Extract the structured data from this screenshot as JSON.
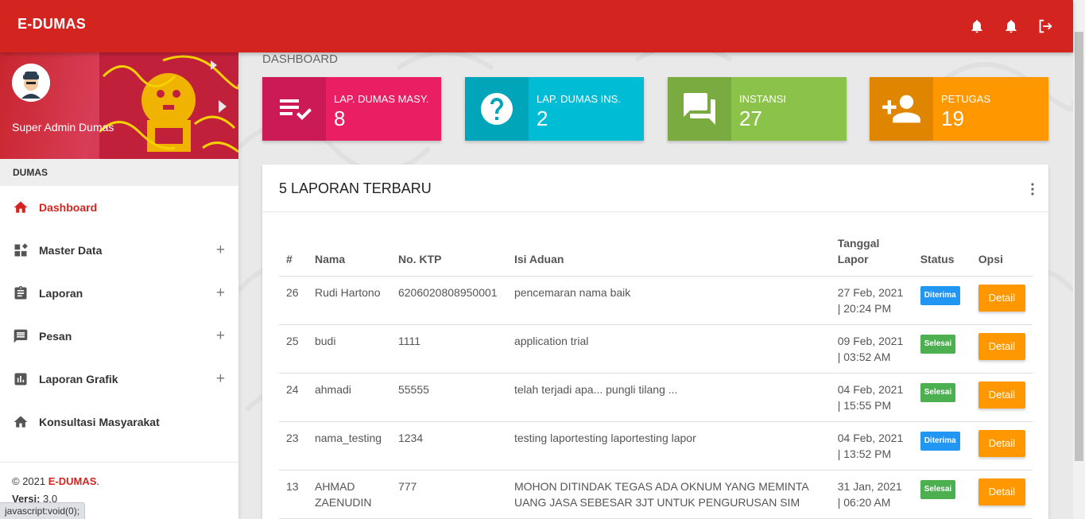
{
  "app": {
    "brand": "E-DUMAS"
  },
  "topbar": {
    "icons": [
      "bell-icon",
      "bell-icon",
      "logout-icon"
    ]
  },
  "sidebar": {
    "user_name": "Super Admin Dumas",
    "section_header": "DUMAS",
    "items": [
      {
        "label": "Dashboard",
        "icon": "home-icon",
        "active": true,
        "expandable": false
      },
      {
        "label": "Master Data",
        "icon": "dashboard-icon",
        "active": false,
        "expandable": true
      },
      {
        "label": "Laporan",
        "icon": "clipboard-icon",
        "active": false,
        "expandable": true
      },
      {
        "label": "Pesan",
        "icon": "message-icon",
        "active": false,
        "expandable": true
      },
      {
        "label": "Laporan Grafik",
        "icon": "bar-chart-icon",
        "active": false,
        "expandable": true
      },
      {
        "label": "Konsultasi Masyarakat",
        "icon": "home-icon",
        "active": false,
        "expandable": false
      }
    ],
    "plus_symbol": "+",
    "footer": {
      "copyright": "© 2021 ",
      "brand": "E-DUMAS",
      "period": ".",
      "version_label": "Versi:",
      "version_value": " 3.0"
    }
  },
  "status_tooltip": "javascript:void(0);",
  "main": {
    "page_title": "DASHBOARD",
    "info_boxes": [
      {
        "label": "LAP. DUMAS MASY.",
        "value": "8",
        "color": "#e91e63",
        "icon": "playlist-check-icon"
      },
      {
        "label": "LAP. DUMAS INS.",
        "value": "2",
        "color": "#00bcd4",
        "icon": "help-icon"
      },
      {
        "label": "INSTANSI",
        "value": "27",
        "color": "#8bc34a",
        "icon": "forum-icon"
      },
      {
        "label": "PETUGAS",
        "value": "19",
        "color": "#ff9800",
        "icon": "person-add-icon"
      }
    ],
    "card": {
      "title": "5 LAPORAN TERBARU",
      "columns": [
        "#",
        "Nama",
        "No. KTP",
        "Isi Aduan",
        "Tanggal Lapor",
        "Status",
        "Opsi"
      ],
      "rows": [
        {
          "id": "26",
          "nama": "Rudi Hartono",
          "ktp": "6206020808950001",
          "isi": "pencemaran nama baik",
          "tanggal": "27 Feb, 2021",
          "jam": "| 20:24 PM",
          "status": "Diterima",
          "opsi": "Detail"
        },
        {
          "id": "25",
          "nama": "budi",
          "ktp": "1111",
          "isi": "application trial",
          "tanggal": "09 Feb, 2021",
          "jam": "| 03:52 AM",
          "status": "Selesai",
          "opsi": "Detail"
        },
        {
          "id": "24",
          "nama": "ahmadi",
          "ktp": "55555",
          "isi": "telah terjadi apa... pungli tilang ...",
          "tanggal": "04 Feb, 2021",
          "jam": "| 15:55 PM",
          "status": "Selesai",
          "opsi": "Detail"
        },
        {
          "id": "23",
          "nama": "nama_testing",
          "ktp": "1234",
          "isi": "testing laportesting laportesting lapor",
          "tanggal": "04 Feb, 2021",
          "jam": "| 13:52 PM",
          "status": "Diterima",
          "opsi": "Detail"
        },
        {
          "id": "13",
          "nama": "AHMAD ZAENUDIN",
          "ktp": "777",
          "isi": "MOHON DITINDAK TEGAS ADA OKNUM YANG MEMINTA UANG JASA SEBESAR 3JT UNTUK PENGURUSAN SIM",
          "tanggal": "31 Jan, 2021",
          "jam": "| 06:20 AM",
          "status": "Selesai",
          "opsi": "Detail"
        }
      ],
      "status_colors": {
        "Diterima": "#2196f3",
        "Selesai": "#4caf50"
      }
    }
  }
}
